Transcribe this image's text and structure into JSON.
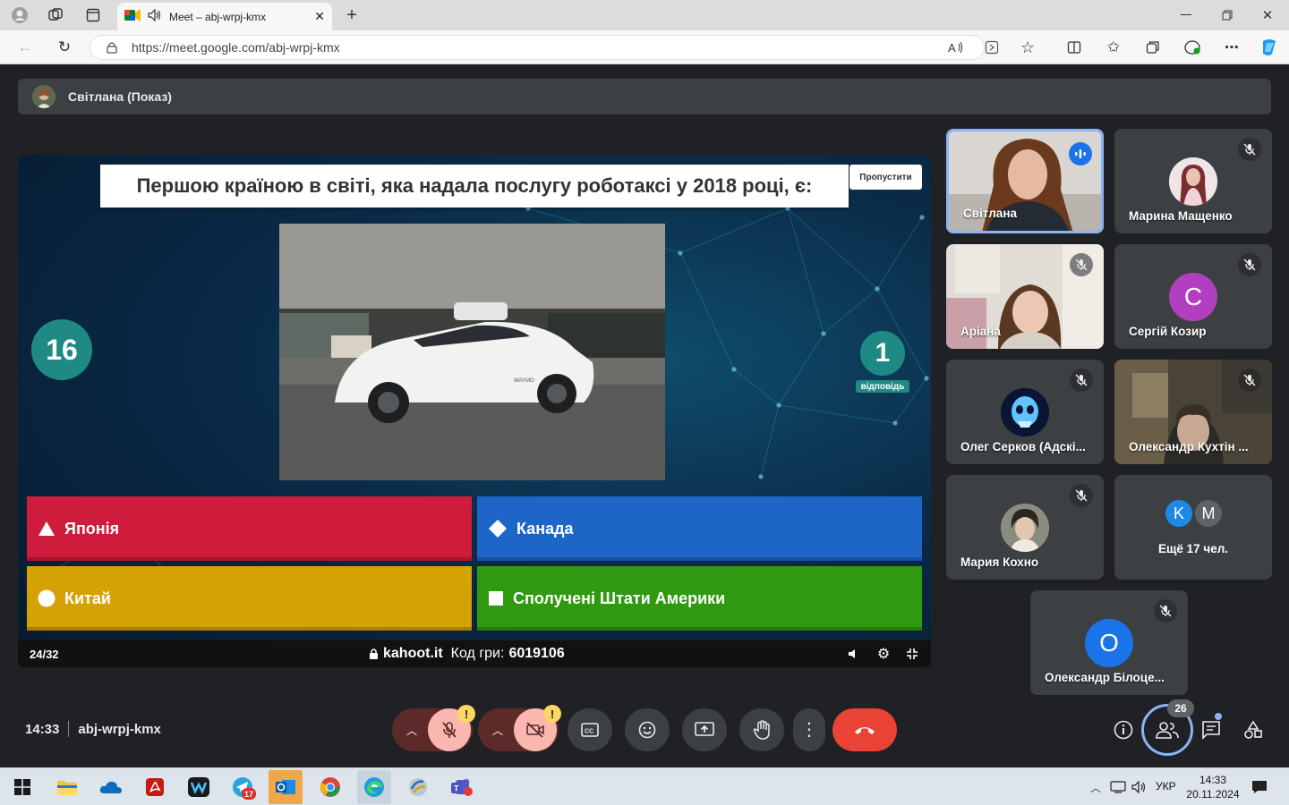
{
  "browser": {
    "tab_title": "Meet – abj-wrpj-kmx",
    "url": "https://meet.google.com/abj-wrpj-kmx",
    "reader_aa": "Aʘ"
  },
  "presenter": {
    "name": "Світлана (Показ)"
  },
  "kahoot": {
    "question": "Першою країною в світі, яка надала послугу роботаксі у 2018 році, є:",
    "skip_label": "Пропустити",
    "timer": "16",
    "answers_count": "1",
    "answers_label": "відповідь",
    "answers": [
      {
        "shape": "triangle",
        "label": "Японія",
        "color": "#d01c3c"
      },
      {
        "shape": "diamond",
        "label": "Канада",
        "color": "#1d66c8"
      },
      {
        "shape": "circle",
        "label": "Китай",
        "color": "#d5a204"
      },
      {
        "shape": "square",
        "label": "Сполучені Штати Америки",
        "color": "#2f9a0f"
      }
    ],
    "progress": "24/32",
    "site": "kahoot.it",
    "code_label": "Код гри:",
    "code": "6019106",
    "photo_brand": "WAYMO"
  },
  "participants": [
    {
      "name": "Світлана",
      "mic": "speaking",
      "type": "video",
      "active": true
    },
    {
      "name": "Марина Мащенко",
      "mic": "muted",
      "type": "avatar-photo"
    },
    {
      "name": "Аріана",
      "mic": "muted",
      "type": "video"
    },
    {
      "name": "Сергій Козир",
      "mic": "muted",
      "type": "letter",
      "letter": "С",
      "color": "#b23fbf"
    },
    {
      "name": "Олег Серков (Адскі...",
      "mic": "muted",
      "type": "avatar-photo"
    },
    {
      "name": "Олександр Кухтін ...",
      "mic": "muted",
      "type": "video"
    },
    {
      "name": "Мария Кохно",
      "mic": "muted",
      "type": "avatar-photo"
    },
    {
      "name": "Ещё 17 чел.",
      "type": "more",
      "letters": [
        "K",
        "M"
      ],
      "colors": [
        "#1e88e5",
        "#5f6368"
      ]
    },
    {
      "name": "Олександр Білоце...",
      "mic": "muted",
      "type": "letter",
      "letter": "O",
      "color": "#1a73e8"
    }
  ],
  "meeting": {
    "time": "14:33",
    "code": "abj-wrpj-kmx",
    "people_count": "26"
  },
  "taskbar": {
    "lang": "УКР",
    "time": "14:33",
    "date": "20.11.2024",
    "telegram_badge": "17"
  }
}
